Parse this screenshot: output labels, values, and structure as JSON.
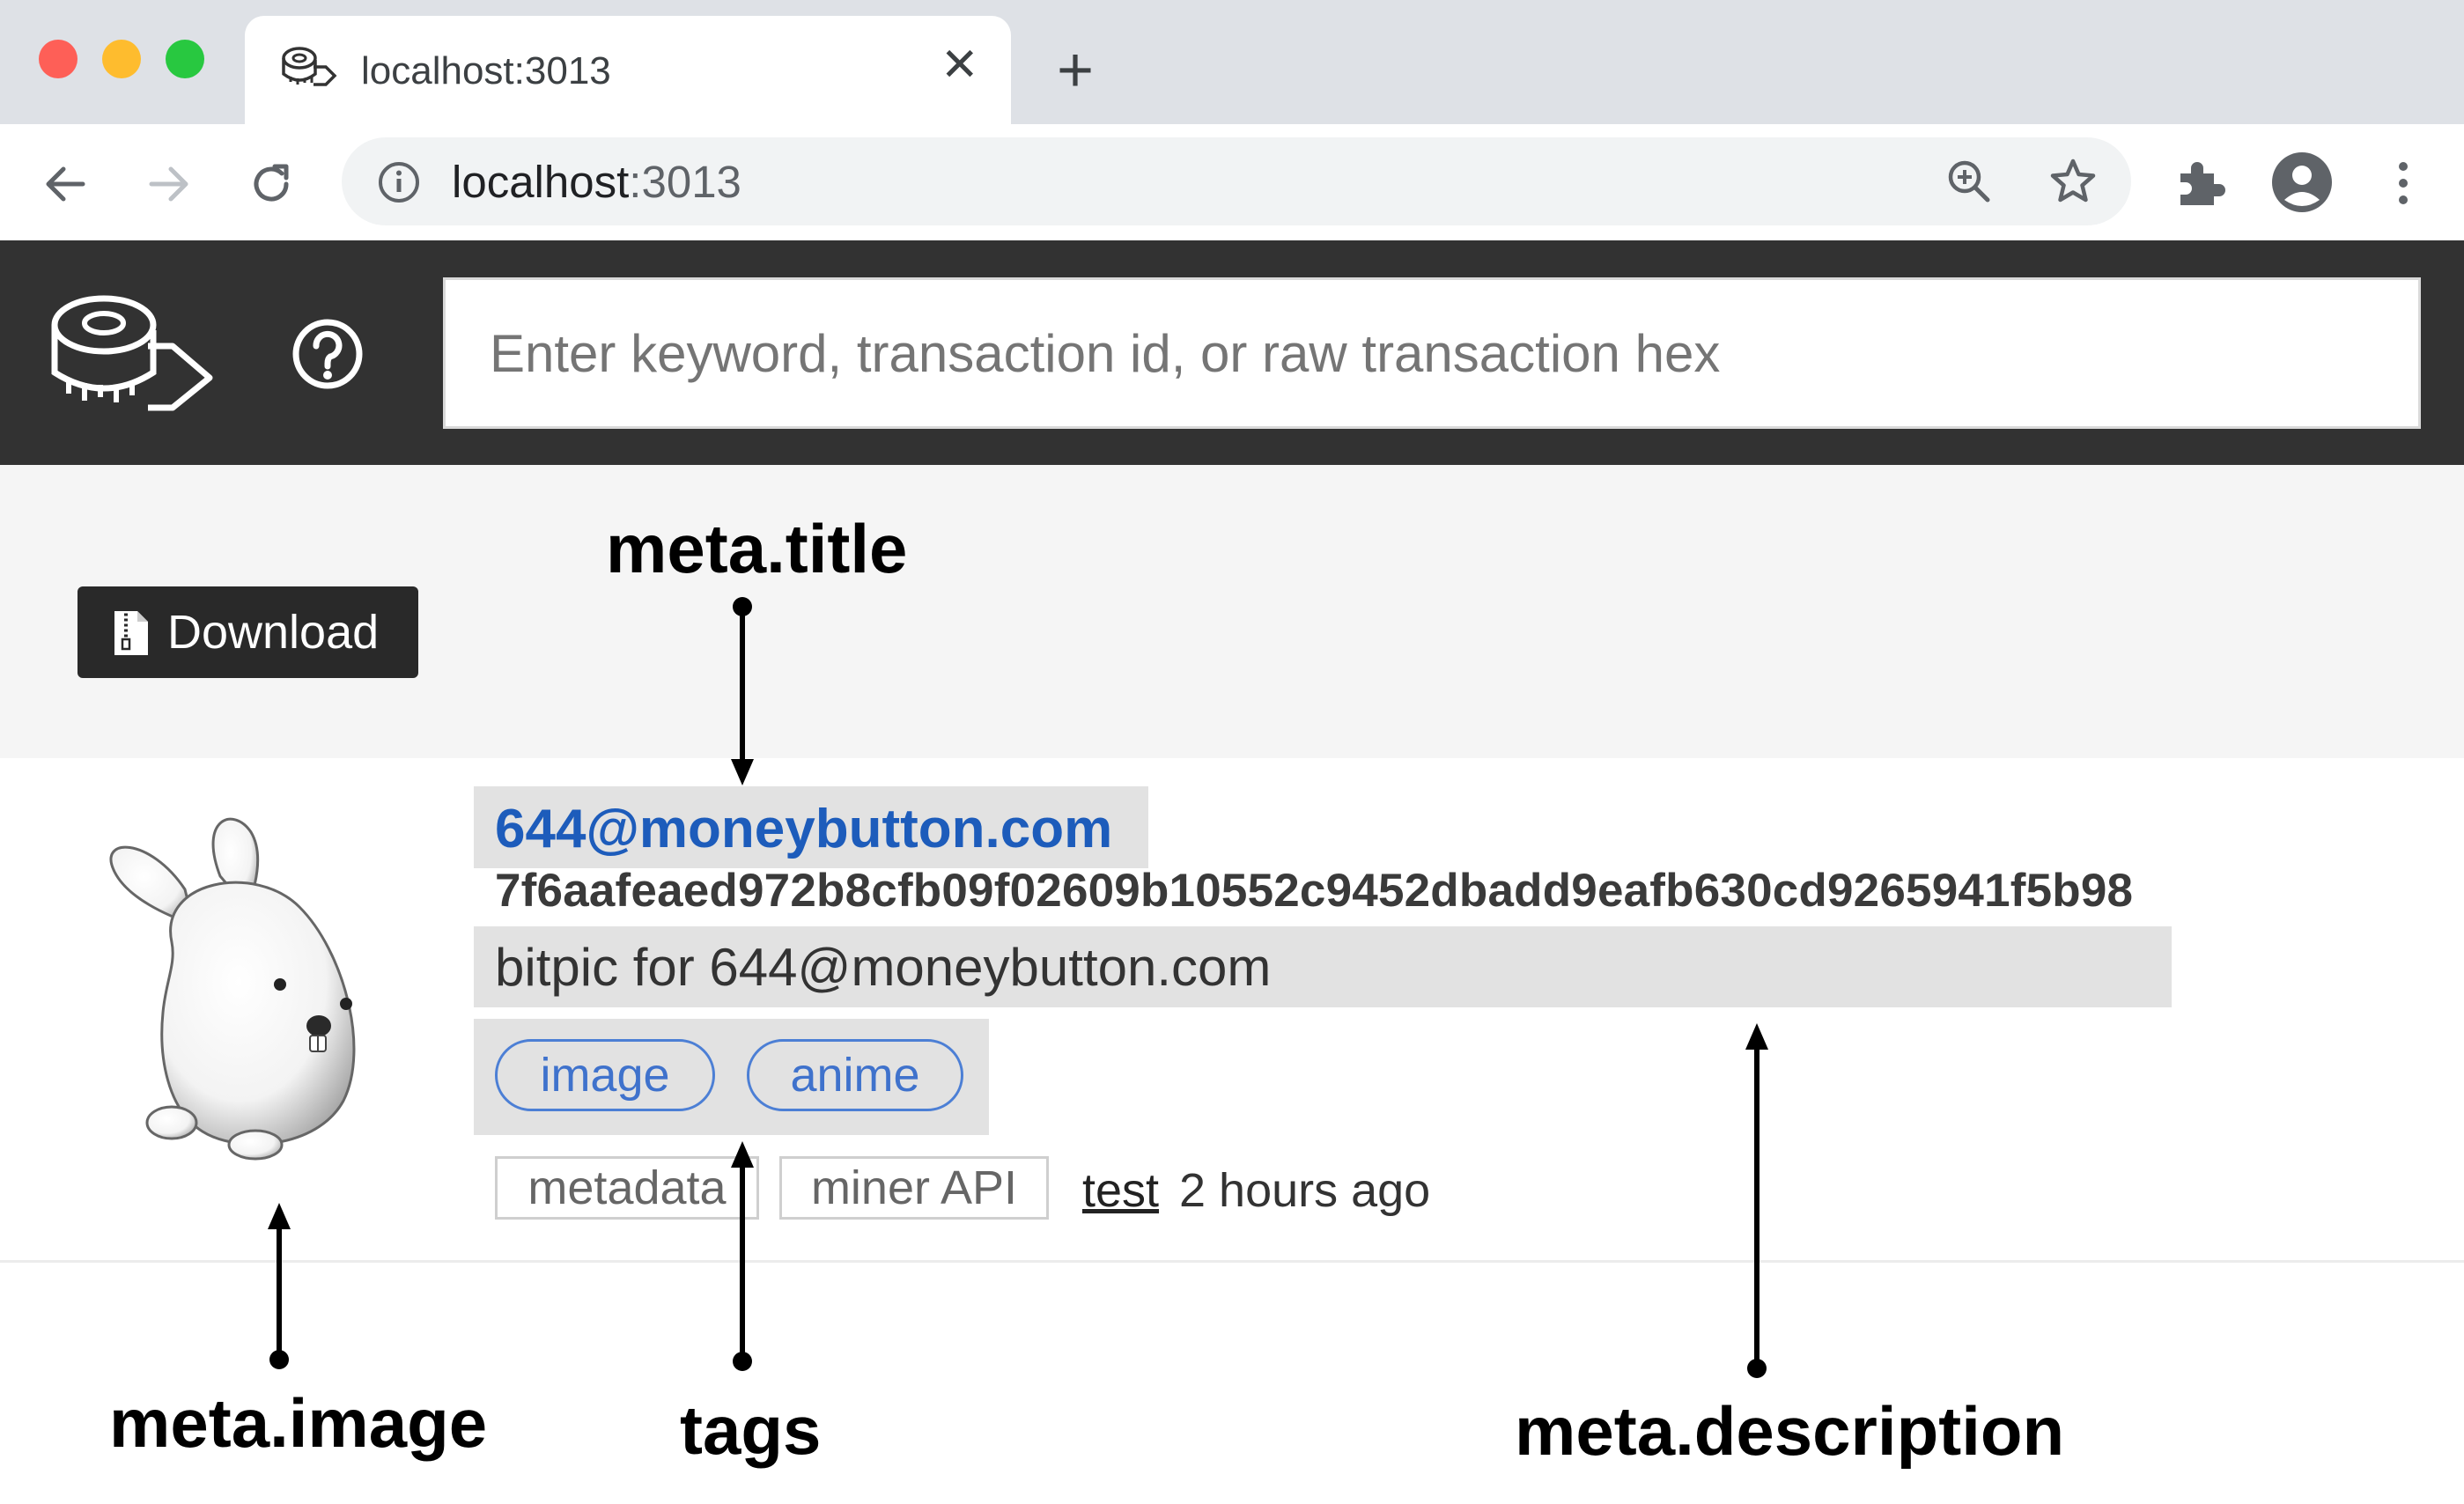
{
  "browser": {
    "tab_title": "localhost:3013",
    "close_glyph": "✕",
    "new_tab_glyph": "+",
    "url_host": "localhost",
    "url_port": ":3013",
    "colors": {
      "red": "#fe5f57",
      "yellow": "#febc2e",
      "green": "#28c840"
    },
    "icons": [
      "back-arrow-icon",
      "forward-arrow-icon",
      "reload-icon",
      "info-icon",
      "zoom-icon",
      "star-icon",
      "extensions-icon",
      "profile-icon",
      "menu-icon"
    ]
  },
  "app": {
    "search_placeholder": "Enter keyword, transaction id, or raw transaction hex",
    "download_label": "Download"
  },
  "item": {
    "title": "644@moneybutton.com",
    "txid": "7f6aafeaed972b8cfb09f02609b10552c9452dbadd9eafb630cd9265941f5b98",
    "description": "bitpic for 644@moneybutton.com",
    "tags": [
      "image",
      "anime"
    ],
    "chips": [
      "metadata",
      "miner API"
    ],
    "link": "test",
    "time": "2 hours ago"
  },
  "annotations": {
    "title": "meta.title",
    "image": "meta.image",
    "tags": "tags",
    "description": "meta.description"
  }
}
